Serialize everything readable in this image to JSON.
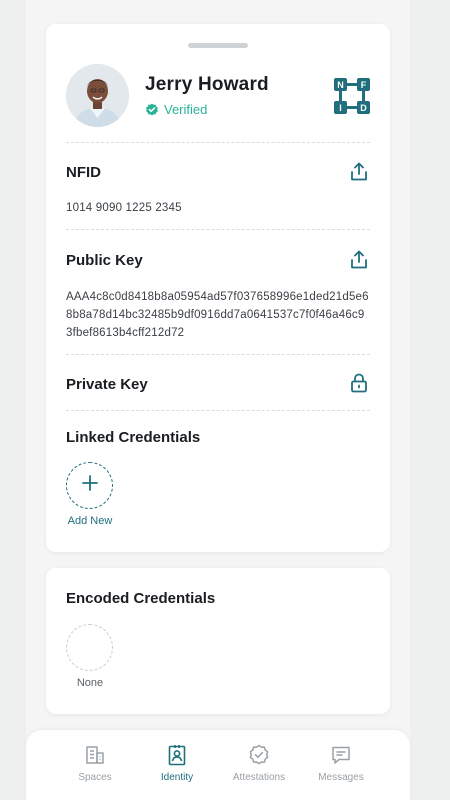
{
  "profile": {
    "name": "Jerry Howard",
    "status": "Verified",
    "logo_letters": [
      "N",
      "F",
      "I",
      "D"
    ]
  },
  "sections": {
    "nfid": {
      "title": "NFID",
      "value": "1014 9090 1225 2345"
    },
    "public_key": {
      "title": "Public Key",
      "value": "AAA4c8c0d8418b8a05954ad57f037658996e1ded21d5e68b8a78d14bc32485b9df0916dd7a0641537c7f0f46a46c93fbef8613b4cff212d72"
    },
    "private_key": {
      "title": "Private Key"
    },
    "linked_credentials": {
      "title": "Linked Credentials",
      "add_label": "Add New"
    }
  },
  "encoded": {
    "title": "Encoded Credentials",
    "empty_label": "None"
  },
  "tabs": [
    {
      "label": "Spaces",
      "icon": "building-icon",
      "active": false
    },
    {
      "label": "Identity",
      "icon": "id-badge-icon",
      "active": true
    },
    {
      "label": "Attestations",
      "icon": "badge-check-icon",
      "active": false
    },
    {
      "label": "Messages",
      "icon": "message-icon",
      "active": false
    }
  ],
  "colors": {
    "accent": "#1f6f7d",
    "verified": "#2bb39a",
    "inactive": "#9aa0a6"
  }
}
